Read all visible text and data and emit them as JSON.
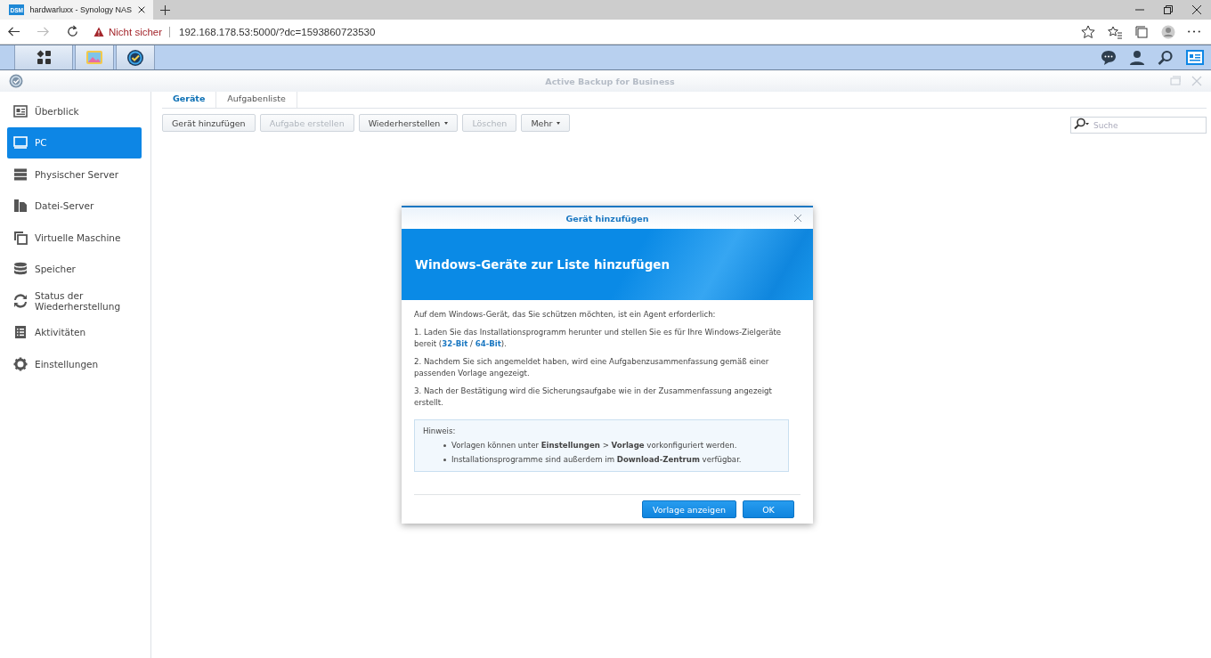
{
  "browser": {
    "tab_title": "hardwarluxx - Synology NAS",
    "favicon": "DSM",
    "security": "Nicht sicher",
    "url": "192.168.178.53:5000/?dc=1593860723530"
  },
  "window": {
    "title": "Active Backup for Business"
  },
  "sidebar": {
    "items": [
      {
        "label": "Überblick",
        "selected": false
      },
      {
        "label": "PC",
        "selected": true
      },
      {
        "label": "Physischer Server",
        "selected": false
      },
      {
        "label": "Datei-Server",
        "selected": false
      },
      {
        "label": "Virtuelle Maschine",
        "selected": false
      },
      {
        "label": "Speicher",
        "selected": false
      },
      {
        "label": "Status der Wiederherstellung",
        "selected": false
      },
      {
        "label": "Aktivitäten",
        "selected": false
      },
      {
        "label": "Einstellungen",
        "selected": false
      }
    ]
  },
  "tabs": [
    {
      "label": "Geräte",
      "selected": true
    },
    {
      "label": "Aufgabenliste",
      "selected": false
    }
  ],
  "toolbar": [
    {
      "label": "Gerät hinzufügen",
      "disabled": false,
      "dropdown": false
    },
    {
      "label": "Aufgabe erstellen",
      "disabled": true,
      "dropdown": false
    },
    {
      "label": "Wiederherstellen",
      "disabled": false,
      "dropdown": true
    },
    {
      "label": "Löschen",
      "disabled": true,
      "dropdown": false
    },
    {
      "label": "Mehr",
      "disabled": false,
      "dropdown": true
    }
  ],
  "search": {
    "placeholder": "Suche"
  },
  "dialog": {
    "title": "Gerät hinzufügen",
    "banner": "Windows-Geräte zur Liste hinzufügen",
    "intro": "Auf dem Windows-Gerät, das Sie schützen möchten, ist ein Agent erforderlich:",
    "steps": [
      {
        "text": "1. Laden Sie das Installationsprogramm herunter und stellen Sie es für Ihre Windows-Zielgeräte bereit (",
        "links": [
          "32-Bit",
          "64-Bit"
        ],
        "separator": " / ",
        "tail": ")."
      },
      {
        "text": "2. Nachdem Sie sich angemeldet haben, wird eine Aufgabenzusammenfassung gemäß einer passenden Vorlage angezeigt."
      },
      {
        "text": "3. Nach der Bestätigung wird die Sicherungsaufgabe wie in der Zusammenfassung angezeigt erstellt."
      }
    ],
    "note": {
      "title": "Hinweis:",
      "items": [
        "Vorlagen können unter **Einstellungen** > **Vorlage** vorkonfiguriert werden.",
        "Installationsprogramme sind außerdem im **Download-Zentrum** verfügbar."
      ]
    },
    "buttons": [
      "Vorlage anzeigen",
      "OK"
    ]
  }
}
